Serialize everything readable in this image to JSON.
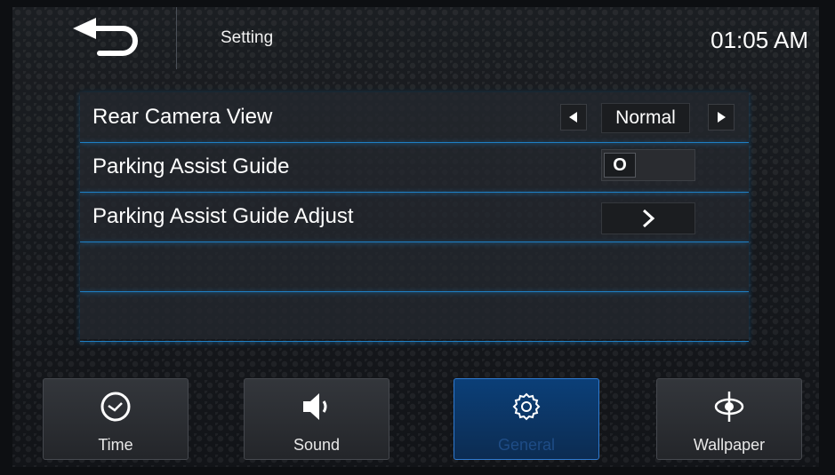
{
  "header": {
    "title": "Setting",
    "clock": "01:05 AM"
  },
  "settings": {
    "rows": [
      {
        "label": "Rear Camera View",
        "control": "selector",
        "value": "Normal"
      },
      {
        "label": "Parking Assist Guide",
        "control": "toggle",
        "toggle_symbol": "O"
      },
      {
        "label": "Parking Assist Guide Adjust",
        "control": "submenu"
      },
      {
        "label": ""
      },
      {
        "label": ""
      }
    ]
  },
  "tabs": [
    {
      "label": "Time",
      "icon": "clock-icon",
      "active": false
    },
    {
      "label": "Sound",
      "icon": "speaker-icon",
      "active": false
    },
    {
      "label": "General",
      "icon": "gear-icon",
      "active": true
    },
    {
      "label": "Wallpaper",
      "icon": "wallpaper-icon",
      "active": false
    }
  ],
  "colors": {
    "accent": "#1e7fc4",
    "active_tab": "#0c3a70"
  }
}
